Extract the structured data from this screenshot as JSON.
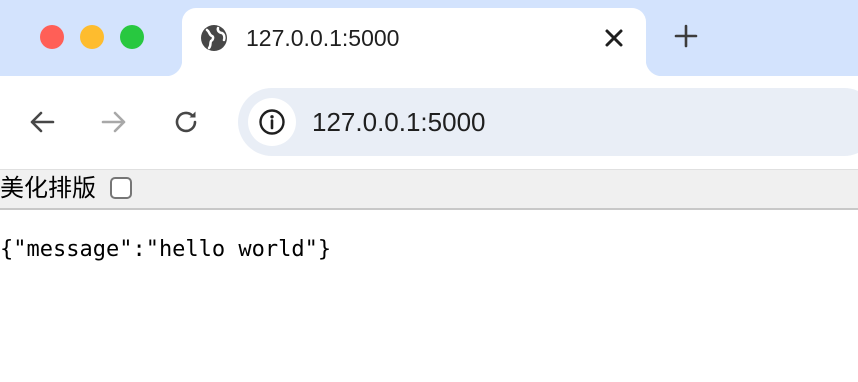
{
  "window": {
    "tab": {
      "title": "127.0.0.1:5000",
      "favicon": "globe-icon"
    },
    "new_tab_icon": "plus-icon"
  },
  "toolbar": {
    "back_icon": "arrow-left-icon",
    "forward_icon": "arrow-right-icon",
    "reload_icon": "reload-icon",
    "address": {
      "site_info_icon": "info-icon",
      "url": "127.0.0.1:5000"
    }
  },
  "page": {
    "pretty_print": {
      "label": "美化排版",
      "checked": false
    },
    "body_text": "{\"message\":\"hello world\"}"
  }
}
